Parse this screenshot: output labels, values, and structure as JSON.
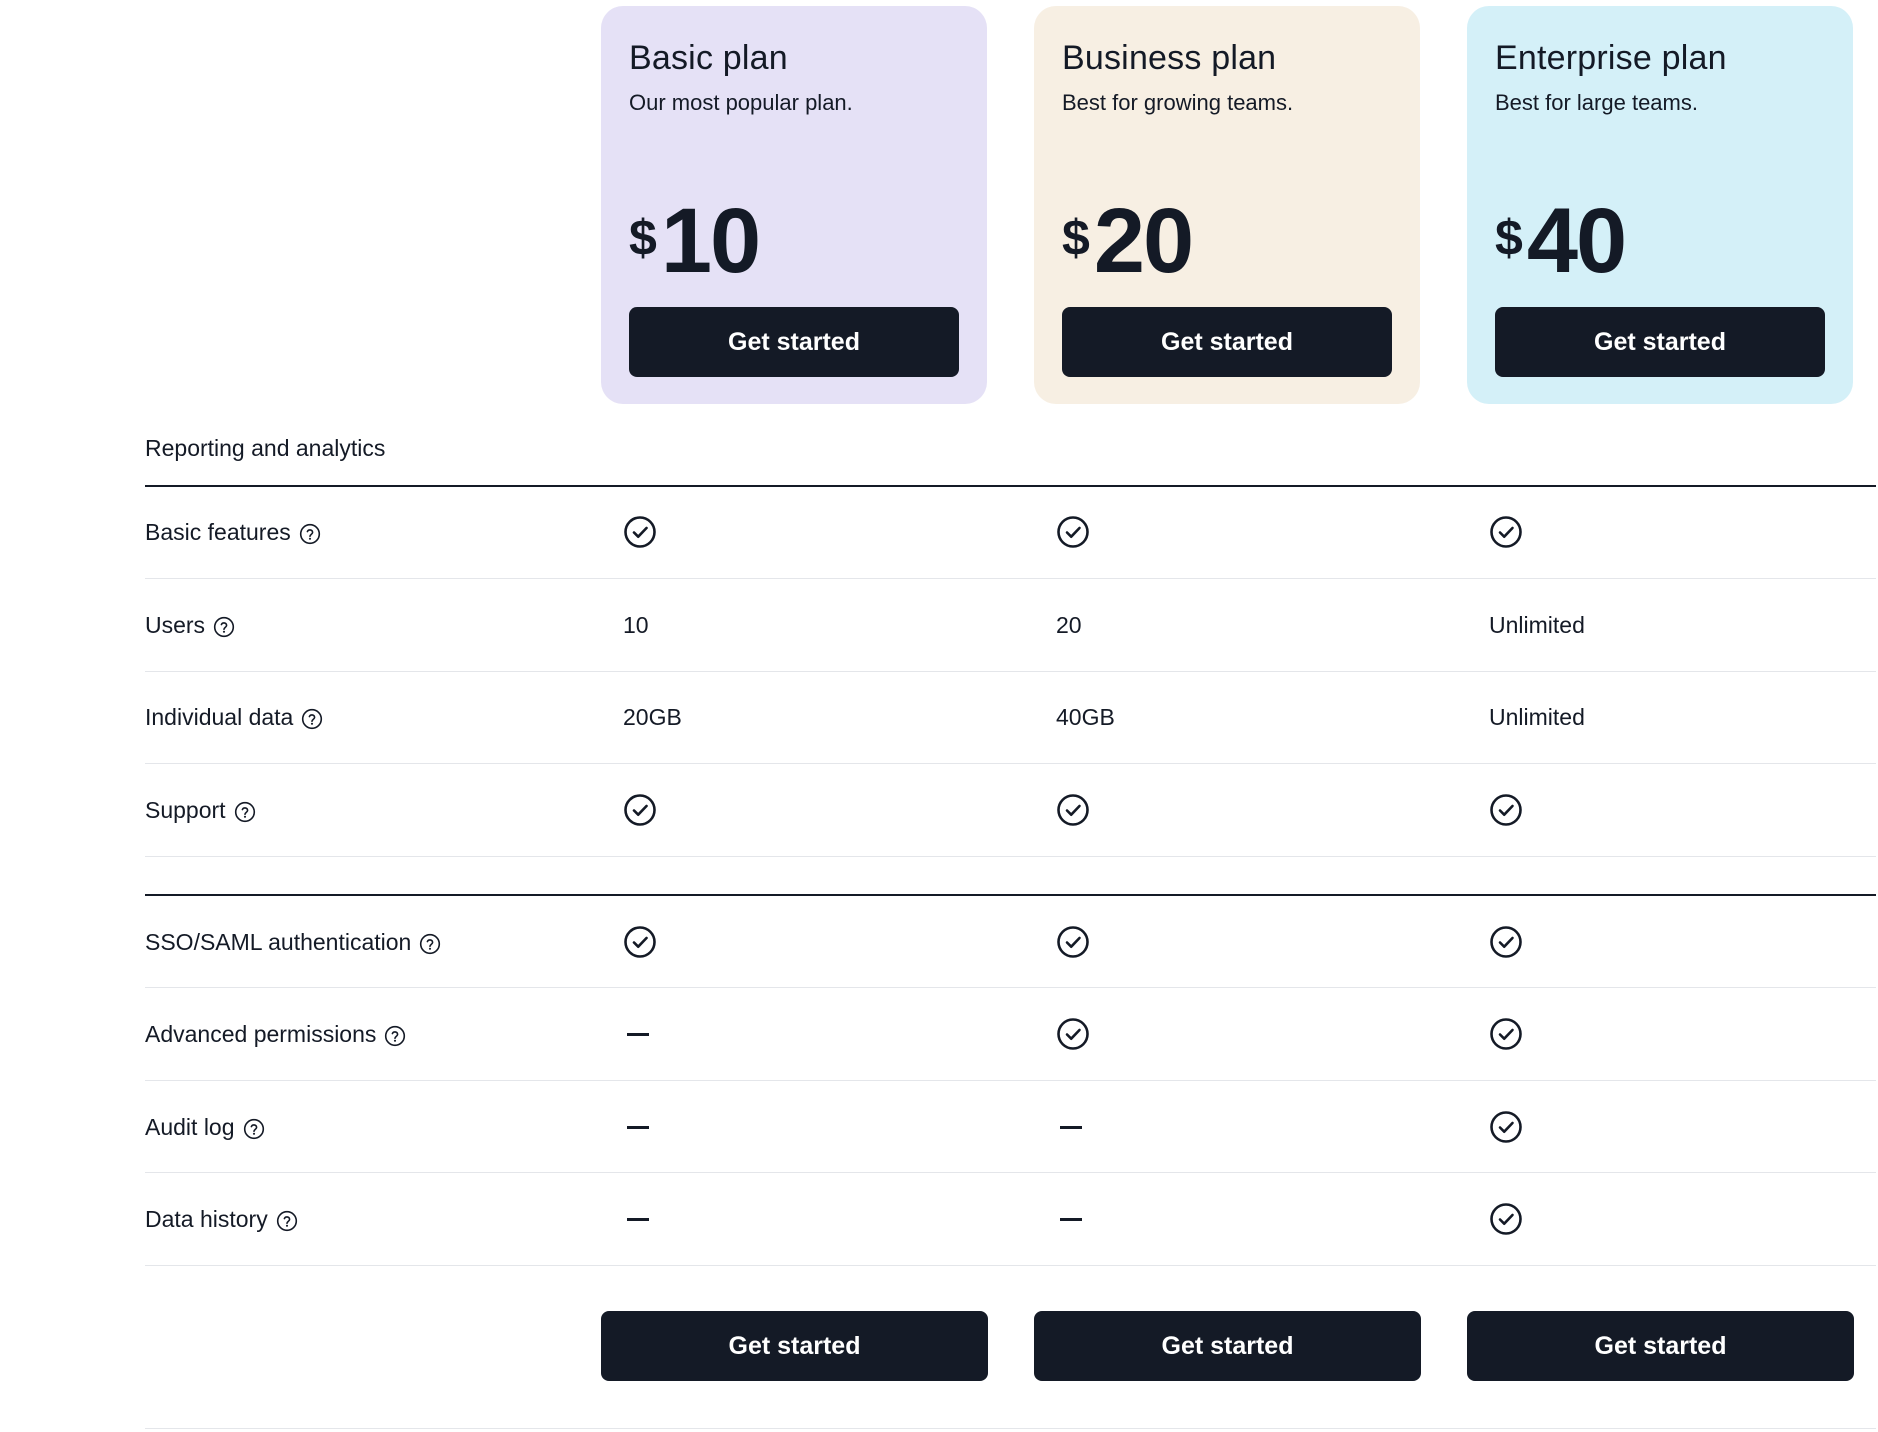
{
  "colors": {
    "basic_bg": "#e5e1f6",
    "business_bg": "#f7efe3",
    "enterprise_bg": "#d4f0f8",
    "button_bg": "#141a26",
    "button_text": "#ffffff"
  },
  "plans": [
    {
      "name": "Basic plan",
      "desc": "Our most popular plan.",
      "currency": "$",
      "price": "10",
      "cta": "Get started"
    },
    {
      "name": "Business plan",
      "desc": "Best for growing teams.",
      "currency": "$",
      "price": "20",
      "cta": "Get started"
    },
    {
      "name": "Enterprise plan",
      "desc": "Best for large teams.",
      "currency": "$",
      "price": "40",
      "cta": "Get started"
    }
  ],
  "section": {
    "title": "Reporting and analytics"
  },
  "rows": [
    {
      "label": "Basic features",
      "values": [
        "check-icon",
        "check-icon",
        "check-icon"
      ]
    },
    {
      "label": "Users",
      "values": [
        "10",
        "20",
        "Unlimited"
      ]
    },
    {
      "label": "Individual data",
      "values": [
        "20GB",
        "40GB",
        "Unlimited"
      ]
    },
    {
      "label": "Support",
      "values": [
        "check-icon",
        "check-icon",
        "check-icon"
      ]
    },
    {
      "label": "SSO/SAML authentication",
      "values": [
        "check-icon",
        "check-icon",
        "check-icon"
      ]
    },
    {
      "label": "Advanced permissions",
      "values": [
        "dash-icon",
        "check-icon",
        "check-icon"
      ]
    },
    {
      "label": "Audit log",
      "values": [
        "dash-icon",
        "dash-icon",
        "check-icon"
      ]
    },
    {
      "label": "Data history",
      "values": [
        "dash-icon",
        "dash-icon",
        "check-icon"
      ]
    }
  ],
  "bottom_ctas": [
    "Get started",
    "Get started",
    "Get started"
  ]
}
